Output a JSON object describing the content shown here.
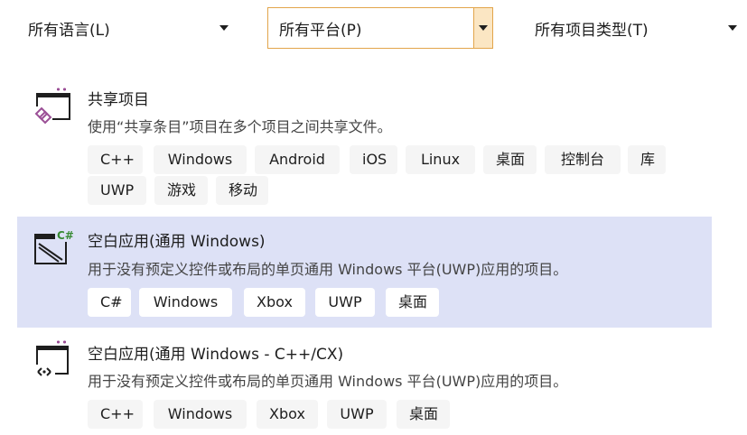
{
  "filters": {
    "language": "所有语言(L)",
    "platform": "所有平台(P)",
    "project_type": "所有项目类型(T)"
  },
  "templates": [
    {
      "title": "共享项目",
      "description": "使用“共享条目”项目在多个项目之间共享文件。",
      "icon": "shared-project-icon",
      "tags": [
        "C++",
        "Windows",
        "Android",
        "iOS",
        "Linux",
        "桌面",
        "控制台",
        "库",
        "UWP",
        "游戏",
        "移动"
      ]
    },
    {
      "title": "空白应用(通用 Windows)",
      "description": "用于没有预定义控件或布局的单页通用 Windows 平台(UWP)应用的项目。",
      "icon": "csharp-uwp-app-icon",
      "tags": [
        "C#",
        "Windows",
        "Xbox",
        "UWP",
        "桌面"
      ]
    },
    {
      "title": "空白应用(通用 Windows - C++/CX)",
      "description": "用于没有预定义控件或布局的单页通用 Windows 平台(UWP)应用的项目。",
      "icon": "cpp-uwp-app-icon",
      "tags": [
        "C++",
        "Windows",
        "Xbox",
        "UWP",
        "桌面"
      ]
    }
  ],
  "colors": {
    "selected_background": "#dde1f6",
    "dropdown_focus_border": "#e2a54b",
    "tag_background": "#f5f5f5"
  }
}
